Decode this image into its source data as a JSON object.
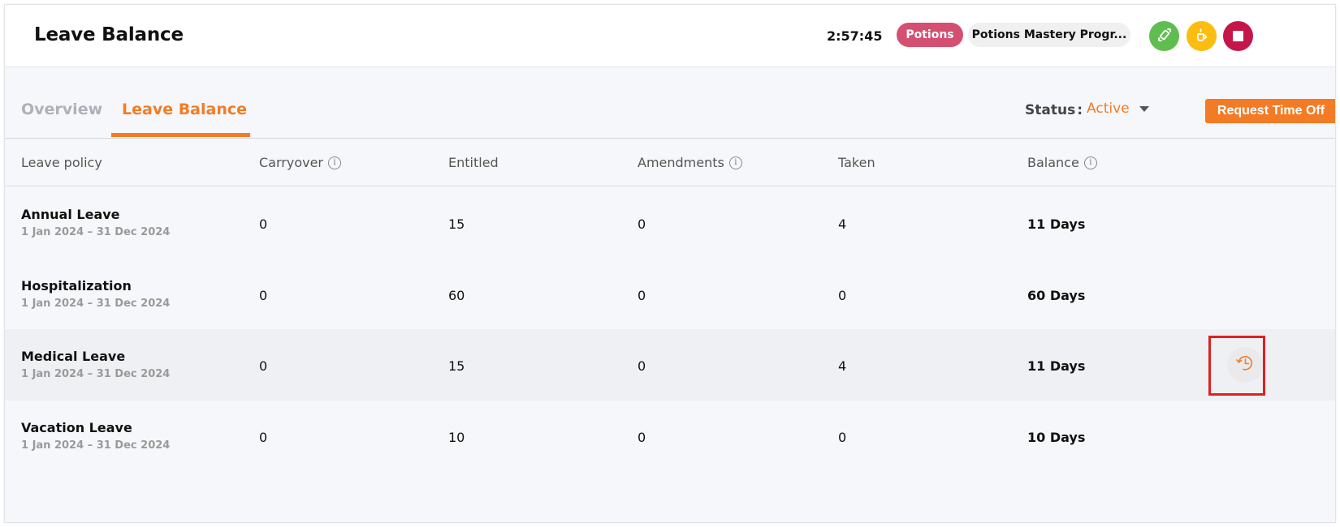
{
  "header": {
    "title": "Leave Balance",
    "timer": "2:57:45",
    "course_pill": "Potions",
    "program_pill": "Potions Mastery Progr...",
    "actions": [
      {
        "name": "switch-icon",
        "color": "#5fbe4f"
      },
      {
        "name": "coffee-break-icon",
        "color": "#fbbd0f"
      },
      {
        "name": "stop-icon",
        "color": "#c5164a"
      }
    ]
  },
  "tabs": [
    {
      "label": "Overview",
      "active": false
    },
    {
      "label": "Leave Balance",
      "active": true
    }
  ],
  "filters": {
    "status_label": "Status",
    "status_colon": ":",
    "status_value": "Active"
  },
  "request_button": "Request Time Off",
  "table": {
    "columns": [
      {
        "label": "Leave policy",
        "info": false
      },
      {
        "label": "Carryover",
        "info": true
      },
      {
        "label": "Entitled",
        "info": false
      },
      {
        "label": "Amendments",
        "info": true
      },
      {
        "label": "Taken",
        "info": false
      },
      {
        "label": "Balance",
        "info": true
      }
    ],
    "info_glyph": "i",
    "rows": [
      {
        "policy": "Annual Leave",
        "range": "1 Jan 2024 – 31 Dec 2024",
        "carryover": "0",
        "entitled": "15",
        "amendments": "0",
        "taken": "4",
        "balance": "11 Days"
      },
      {
        "policy": "Hospitalization",
        "range": "1 Jan 2024 – 31 Dec 2024",
        "carryover": "0",
        "entitled": "60",
        "amendments": "0",
        "taken": "0",
        "balance": "60 Days"
      },
      {
        "policy": "Medical Leave",
        "range": "1 Jan 2024 – 31 Dec 2024",
        "carryover": "0",
        "entitled": "15",
        "amendments": "0",
        "taken": "4",
        "balance": "11 Days",
        "hovered": true
      },
      {
        "policy": "Vacation Leave",
        "range": "1 Jan 2024 – 31 Dec 2024",
        "carryover": "0",
        "entitled": "10",
        "amendments": "0",
        "taken": "0",
        "balance": "10 Days"
      }
    ]
  },
  "colors": {
    "accent": "#f47b25",
    "potions_pill": "#d44f72",
    "highlight_box": "#e02020"
  }
}
